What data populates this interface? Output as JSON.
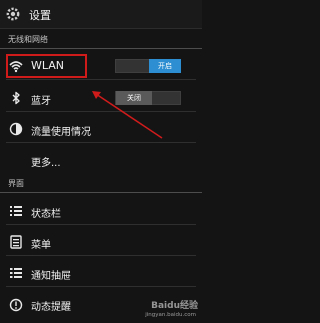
{
  "header": {
    "title": "设置",
    "icon": "settings-icon"
  },
  "sections": {
    "wireless": "无线和网络",
    "display": "界面"
  },
  "wireless_items": {
    "wlan": {
      "label": "WLAN",
      "icon": "wifi-icon",
      "toggle": "开启",
      "state": "on"
    },
    "bluetooth": {
      "label": "蓝牙",
      "icon": "bluetooth-icon",
      "toggle": "关闭",
      "state": "off"
    },
    "data_usage": {
      "label": "流量使用情况",
      "icon": "data-usage-icon"
    },
    "more": {
      "label": "更多..."
    }
  },
  "display_items": {
    "status_bar": {
      "label": "状态栏",
      "icon": "status-bar-icon"
    },
    "menu": {
      "label": "菜单",
      "icon": "menu-icon"
    },
    "notification_drawer": {
      "label": "通知抽屉",
      "icon": "notification-drawer-icon"
    },
    "dynamic_reminder": {
      "label": "动态提醒",
      "icon": "reminder-icon"
    }
  },
  "watermark": {
    "brand": "Baidu经验",
    "url": "jingyan.baidu.com"
  },
  "colors": {
    "accent_on": "#2d8fd1",
    "highlight_box": "#d01b1b",
    "background": "#141414"
  }
}
